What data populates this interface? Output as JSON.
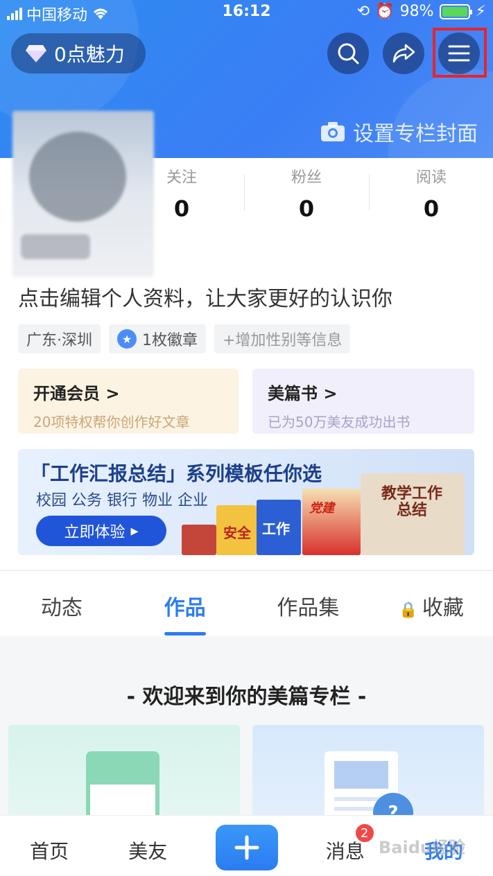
{
  "status": {
    "carrier": "中国移动",
    "time": "16:12",
    "battery": "98%"
  },
  "header": {
    "charm": "0点魅力",
    "set_cover": "设置专栏封面"
  },
  "stats": [
    {
      "label": "关注",
      "value": "0"
    },
    {
      "label": "粉丝",
      "value": "0"
    },
    {
      "label": "阅读",
      "value": "0"
    }
  ],
  "bio": "点击编辑个人资料，让大家更好的认识你",
  "tags": {
    "location": "广东·深圳",
    "badges": "1枚徽章",
    "add_info": "+增加性别等信息"
  },
  "promos": {
    "vip": {
      "title": "开通会员 >",
      "subtitle": "20项特权帮你创作好文章"
    },
    "book": {
      "title": "美篇书 >",
      "subtitle": "已为50万美友成功出书"
    }
  },
  "banner": {
    "title": "「工作汇报总结」系列模板任你选",
    "subtitle": "校园 公务 银行 物业 企业",
    "cta": "立即体验",
    "book_labels": [
      "安全",
      "工作",
      "党建",
      "教学工作总结"
    ]
  },
  "tabs": [
    {
      "label": "动态",
      "active": false
    },
    {
      "label": "作品",
      "active": true
    },
    {
      "label": "作品集",
      "active": false
    },
    {
      "label": "收藏",
      "active": false
    }
  ],
  "welcome": "- 欢迎来到你的美篇专栏 -",
  "bottom_nav": {
    "home": "首页",
    "friends": "美友",
    "messages": "消息",
    "messages_badge": "2",
    "mine": "我的"
  },
  "watermark": "Baidu经验",
  "colors": {
    "accent": "#2d7df0",
    "highlight": "#e8242a",
    "header": "#3a7ef5"
  }
}
